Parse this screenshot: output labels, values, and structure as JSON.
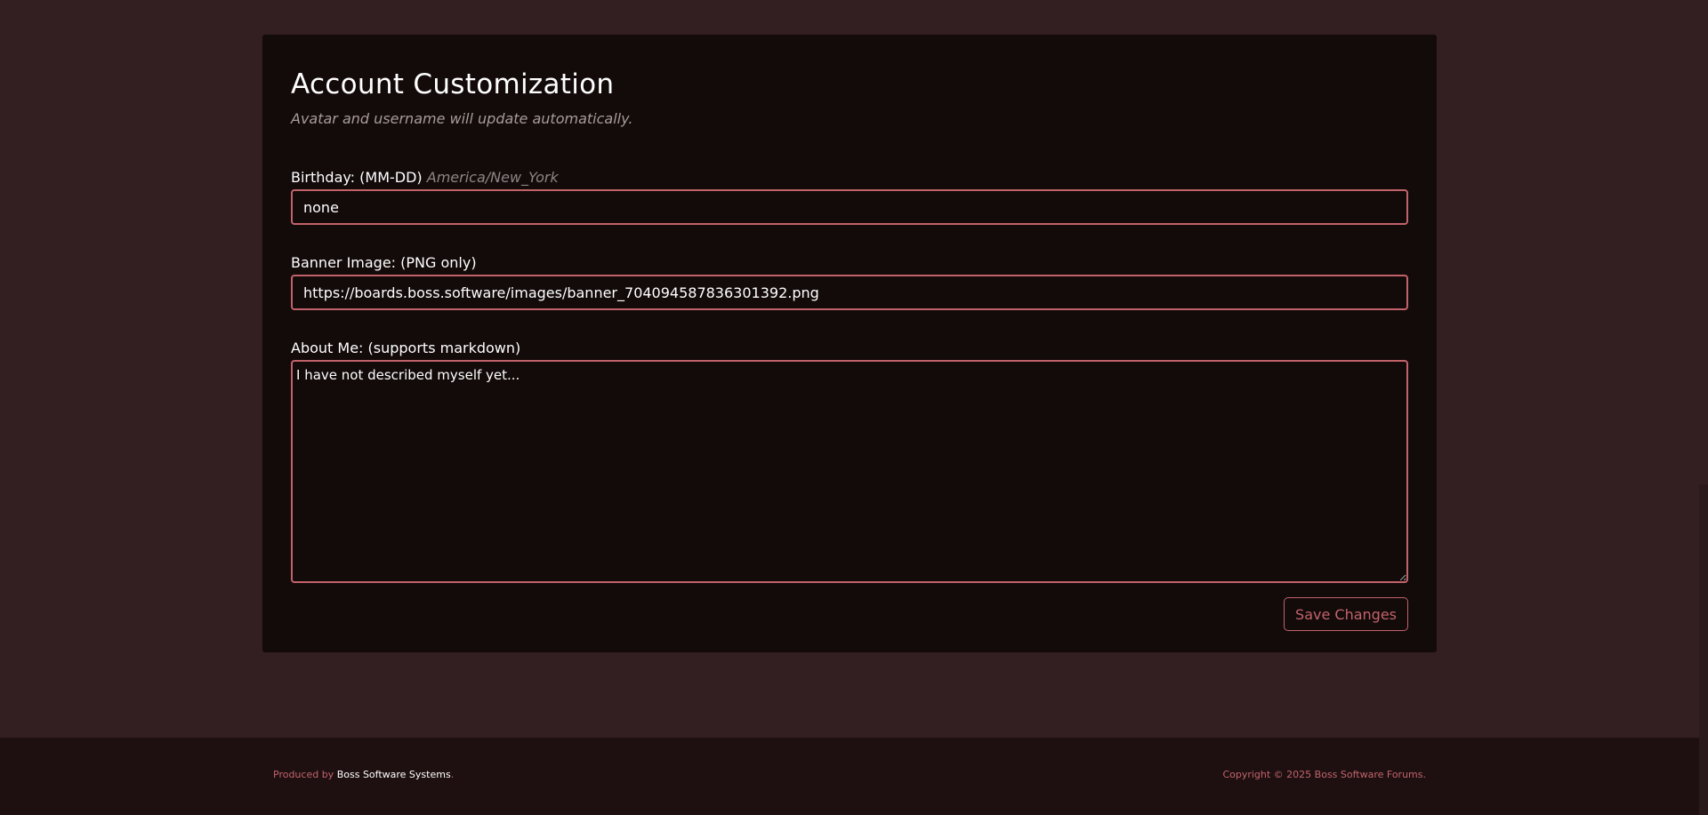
{
  "form": {
    "title": "Account Customization",
    "subtitle": "Avatar and username will update automatically.",
    "birthday": {
      "label": "Birthday: (MM-DD)",
      "timezone": "America/New_York",
      "value": "none"
    },
    "banner": {
      "label": "Banner Image: (PNG only)",
      "value": "https://boards.boss.software/images/banner_704094587836301392.png"
    },
    "about": {
      "label": "About Me: (supports markdown)",
      "value": "I have not described myself yet..."
    },
    "save_label": "Save Changes"
  },
  "footer": {
    "produced_prefix": "Produced by",
    "produced_brand": "Boss Software Systems",
    "produced_suffix": ".",
    "copyright": "Copyright © 2025 Boss Software Forums."
  },
  "colors": {
    "background": "#331e21",
    "card": "#130a0a",
    "accent": "#c2636b",
    "footer": "#1e1011"
  }
}
